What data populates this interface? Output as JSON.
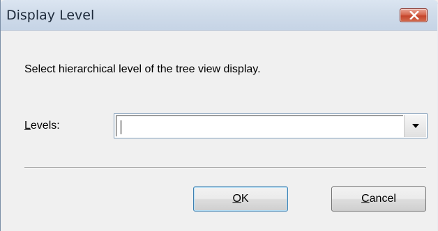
{
  "window": {
    "title": "Display Level",
    "close_icon": "close-icon"
  },
  "dialog": {
    "instruction": "Select hierarchical level of the tree view display.",
    "levels_label_mnemonic": "L",
    "levels_label_rest": "evels:",
    "levels_value": "",
    "ok_mnemonic": "O",
    "ok_rest": "K",
    "cancel_mnemonic": "C",
    "cancel_rest": "ancel"
  },
  "colors": {
    "titlebar": "#d0dcea",
    "close_button": "#c5452c",
    "dialog_bg": "#f0f0f0",
    "default_button_border": "#3c7fb1"
  }
}
